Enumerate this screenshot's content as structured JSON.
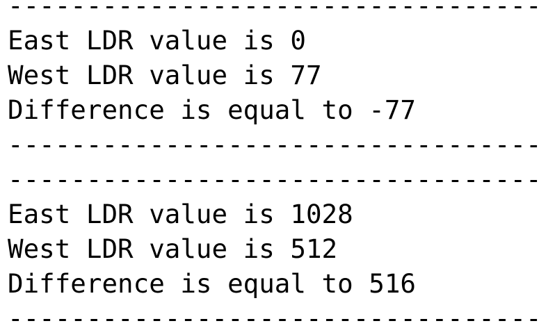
{
  "console": {
    "lines": [
      "----------------------------------------",
      "East LDR value is 0",
      "West LDR value is 77",
      "Difference is equal to -77",
      "----------------------------------------",
      "----------------------------------------",
      "East LDR value is 1028",
      "West LDR value is 512",
      "Difference is equal to 516",
      "----------------------------------------"
    ]
  }
}
